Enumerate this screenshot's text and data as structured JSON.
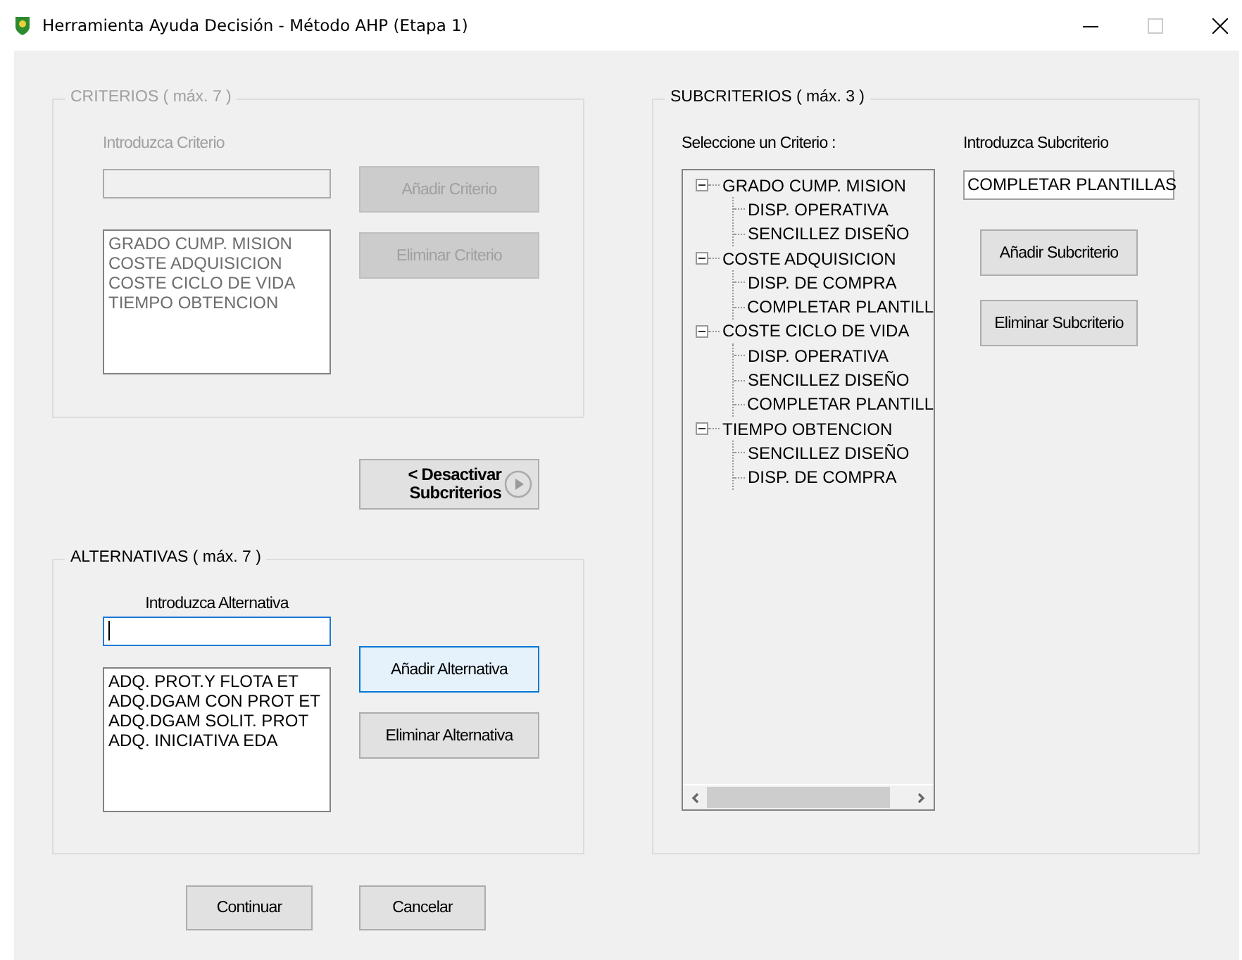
{
  "window": {
    "title": "Herramienta Ayuda Decisión - Método AHP (Etapa 1)"
  },
  "criterios": {
    "title": "CRITERIOS ( máx. 7 )",
    "disabled": true,
    "label": "Introduzca Criterio",
    "add_button": "Añadir Criterio",
    "remove_button": "Eliminar Criterio",
    "items": [
      "GRADO CUMP. MISION",
      "COSTE ADQUISICION",
      "COSTE CICLO DE VIDA",
      "TIEMPO OBTENCION"
    ]
  },
  "toggle_button": {
    "line_1": "<  Desactivar",
    "line_2": "Subcriterios"
  },
  "alternativas": {
    "title": "ALTERNATIVAS ( máx. 7 )",
    "label": "Introduzca Alternativa",
    "focused": true,
    "add_button": {
      "label": "Añadir Alternativa",
      "focused": true
    },
    "remove_button": {
      "label": "Eliminar Alternativa",
      "focused": false
    },
    "items": [
      "ADQ. PROT.Y FLOTA ET",
      "ADQ.DGAM CON PROT ET",
      "ADQ.DGAM SOLIT. PROT",
      "ADQ. INICIATIVA EDA"
    ]
  },
  "subcriterios": {
    "title": "SUBCRITERIOS ( máx. 3 )",
    "tree_label": "Seleccione un Criterio :",
    "input_label": "Introduzca Subcriterio",
    "input_value": "COMPLETAR PLANTILLAS",
    "add_button": "Añadir Subcriterio",
    "remove_button": "Eliminar Subcriterio",
    "tree": [
      {
        "label": "GRADO CUMP. MISION",
        "expanded": true,
        "children": [
          {
            "label": "DISP. OPERATIVA"
          },
          {
            "label": "SENCILLEZ DISEÑO"
          }
        ]
      },
      {
        "label": "COSTE ADQUISICION",
        "expanded": true,
        "children": [
          {
            "label": "DISP. DE COMPRA"
          },
          {
            "label": "COMPLETAR PLANTILL"
          }
        ]
      },
      {
        "label": "COSTE CICLO DE VIDA",
        "expanded": true,
        "children": [
          {
            "label": "DISP. OPERATIVA"
          },
          {
            "label": "SENCILLEZ DISEÑO"
          },
          {
            "label": "COMPLETAR PLANTILL"
          }
        ]
      },
      {
        "label": "TIEMPO OBTENCION",
        "expanded": true,
        "children": [
          {
            "label": "SENCILLEZ DISEÑO"
          },
          {
            "label": "DISP. DE COMPRA"
          }
        ]
      }
    ]
  },
  "buttons": [
    "Continuar",
    "Cancelar"
  ]
}
